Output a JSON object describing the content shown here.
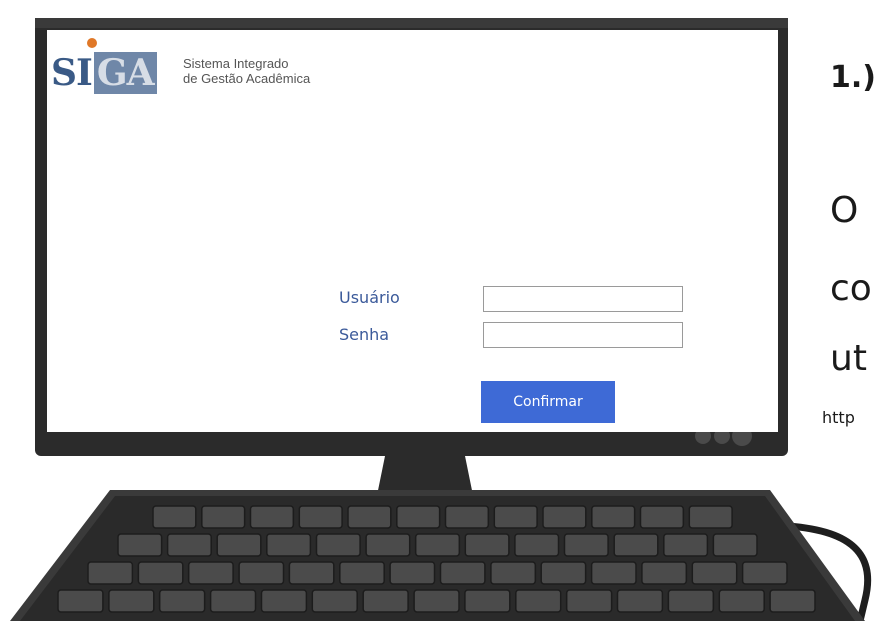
{
  "logo": {
    "mark_left": "SI",
    "mark_right": "GA",
    "line1": "Sistema Integrado",
    "line2": "de Gestão Acadêmica"
  },
  "login": {
    "user_label": "Usuário",
    "password_label": "Senha",
    "user_value": "",
    "password_value": "",
    "confirm_label": "Confirmar"
  },
  "side": {
    "step": "1.)",
    "line1": "O",
    "line2": "co",
    "line3": "ut",
    "line4": "http"
  },
  "colors": {
    "bezel": "#2b2b2b",
    "label_blue": "#3b5a9a",
    "button_blue": "#3e6ad6",
    "logo_dot": "#e07828"
  }
}
